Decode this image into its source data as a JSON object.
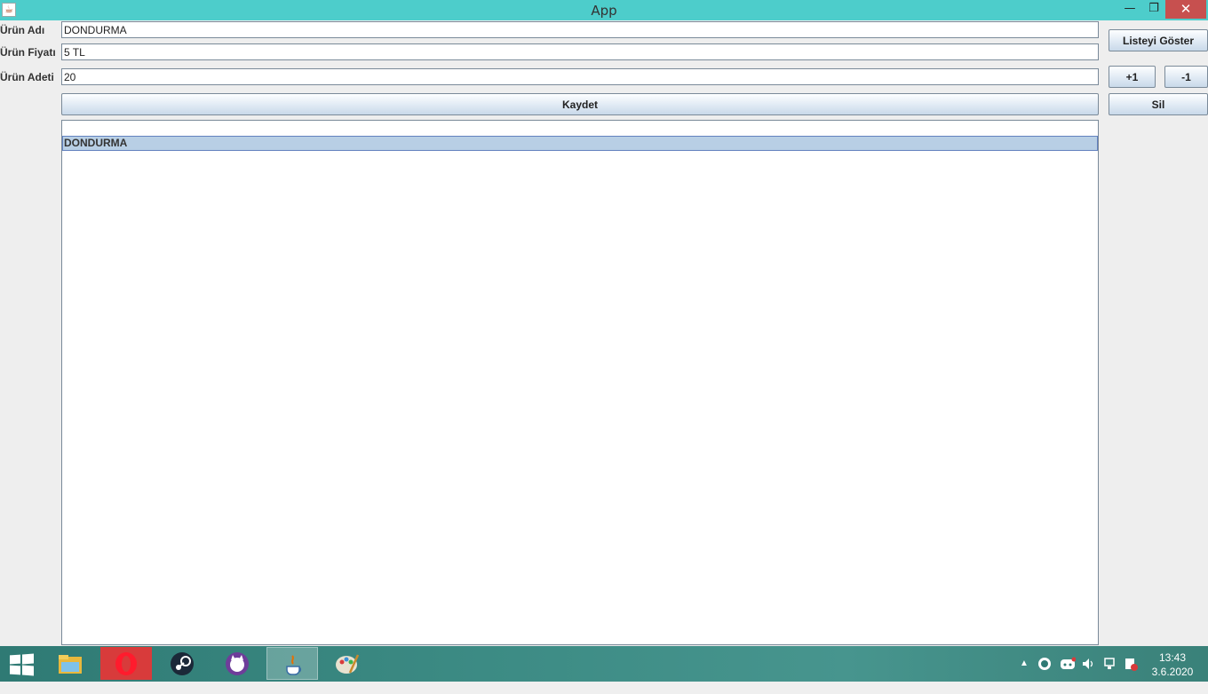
{
  "window": {
    "title": "App",
    "controls": {
      "minimize": "—",
      "maximize": "❐",
      "close": "✕"
    }
  },
  "form": {
    "name_label": "Ürün Adı",
    "name_value": "DONDURMA",
    "price_label": "Ürün Fiyatı",
    "price_value": "5 TL",
    "qty_label": "Ürün Adeti",
    "qty_value": "20",
    "save_label": "Kaydet"
  },
  "side": {
    "show_list_label": "Listeyi Göster",
    "plus_label": "+1",
    "minus_label": "-1",
    "delete_label": "Sil"
  },
  "list": {
    "items": [
      "DONDURMA"
    ]
  },
  "taskbar": {
    "apps": [
      "start-icon",
      "file-explorer-icon",
      "opera-icon",
      "steam-icon",
      "github-icon",
      "java-icon",
      "paint-icon"
    ],
    "clock_time": "13:43",
    "clock_date": "3.6.2020"
  }
}
